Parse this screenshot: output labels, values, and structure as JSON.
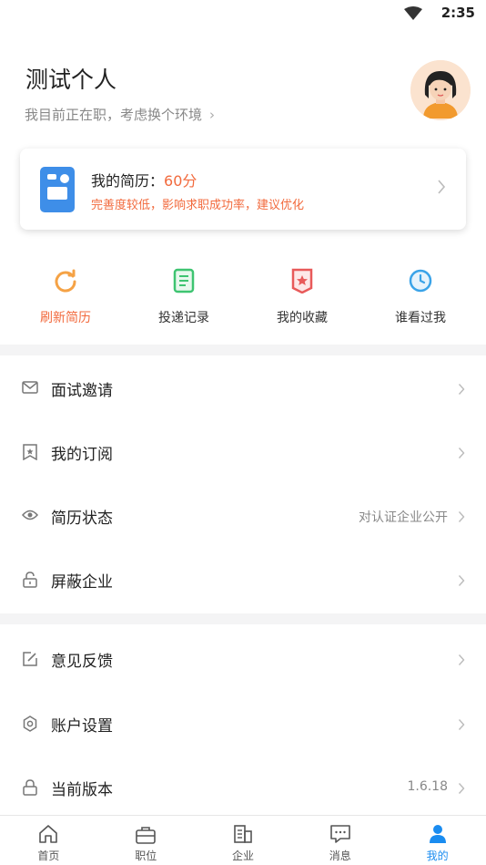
{
  "status_bar": {
    "time": "2:35",
    "wifi_icon": "wifi-icon"
  },
  "profile": {
    "name": "测试个人",
    "job_status": "我目前正在职，考虑换个环境",
    "avatar_icon": "avatar-woman"
  },
  "resume": {
    "title": "我的简历：",
    "score": "60分",
    "hint": "完善度较低，影响求职成功率，建议优化",
    "score_color": "#f26a3d"
  },
  "quick_actions": [
    {
      "label": "刷新简历",
      "icon": "refresh-icon",
      "color": "#f5a245"
    },
    {
      "label": "投递记录",
      "icon": "record-icon",
      "color": "#3ec471"
    },
    {
      "label": "我的收藏",
      "icon": "favorite-icon",
      "color": "#e85a5a"
    },
    {
      "label": "谁看过我",
      "icon": "clock-icon",
      "color": "#3aa3e8"
    }
  ],
  "menu_group1": [
    {
      "label": "面试邀请",
      "icon": "mail-icon",
      "value": ""
    },
    {
      "label": "我的订阅",
      "icon": "bookmark-icon",
      "value": ""
    },
    {
      "label": "简历状态",
      "icon": "eye-icon",
      "value": "对认证企业公开"
    },
    {
      "label": "屏蔽企业",
      "icon": "lock-icon",
      "value": ""
    }
  ],
  "menu_group2": [
    {
      "label": "意见反馈",
      "icon": "edit-icon",
      "value": ""
    },
    {
      "label": "账户设置",
      "icon": "gear-icon",
      "value": ""
    },
    {
      "label": "当前版本",
      "icon": "lock-icon",
      "value": "1.6.18"
    }
  ],
  "tabbar": [
    {
      "label": "首页",
      "icon": "home-icon"
    },
    {
      "label": "职位",
      "icon": "briefcase-icon"
    },
    {
      "label": "企业",
      "icon": "building-icon"
    },
    {
      "label": "消息",
      "icon": "message-icon"
    },
    {
      "label": "我的",
      "icon": "user-icon",
      "active": true
    }
  ],
  "colors": {
    "accent": "#1a8cf0",
    "highlight": "#f26a3d"
  }
}
